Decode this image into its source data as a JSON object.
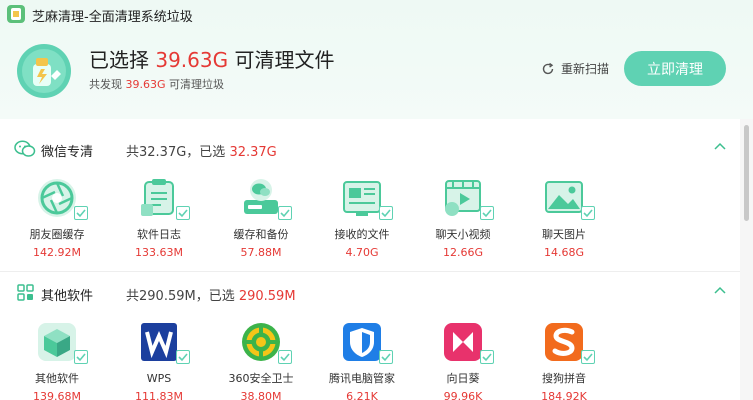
{
  "window": {
    "title": "芝麻清理-全面清理系统垃圾"
  },
  "hero": {
    "main_prefix": "已选择 ",
    "main_value": "39.63G",
    "main_suffix": " 可清理文件",
    "sub_prefix": "共发现 ",
    "sub_value": "39.63G",
    "sub_suffix": " 可清理垃圾"
  },
  "actions": {
    "rescan_label": "重新扫描",
    "clean_label": "立即清理"
  },
  "sections": [
    {
      "title": "微信专清",
      "summary_prefix": "共32.37G，已选 ",
      "summary_value": "32.37G",
      "items": [
        {
          "name": "朋友圈缓存",
          "size": "142.92M",
          "icon": "camera-aperture-icon"
        },
        {
          "name": "软件日志",
          "size": "133.63M",
          "icon": "clipboard-log-icon"
        },
        {
          "name": "缓存和备份",
          "size": "57.88M",
          "icon": "wechat-backup-icon"
        },
        {
          "name": "接收的文件",
          "size": "4.70G",
          "icon": "received-files-icon"
        },
        {
          "name": "聊天小视频",
          "size": "12.66G",
          "icon": "chat-video-icon"
        },
        {
          "name": "聊天图片",
          "size": "14.68G",
          "icon": "chat-image-icon"
        }
      ]
    },
    {
      "title": "其他软件",
      "summary_prefix": "共290.59M，已选 ",
      "summary_value": "290.59M",
      "items": [
        {
          "name": "其他软件",
          "size": "139.68M",
          "icon": "software-box-icon"
        },
        {
          "name": "WPS",
          "size": "111.83M",
          "icon": "wps-icon"
        },
        {
          "name": "360安全卫士",
          "size": "38.80M",
          "icon": "360-security-icon"
        },
        {
          "name": "腾讯电脑管家",
          "size": "6.21K",
          "icon": "tencent-pc-manager-icon"
        },
        {
          "name": "向日葵",
          "size": "99.96K",
          "icon": "sunflower-remote-icon"
        },
        {
          "name": "搜狗拼音",
          "size": "184.92K",
          "icon": "sogou-pinyin-icon"
        }
      ]
    }
  ],
  "colors": {
    "accent": "#5fd2b3",
    "highlight": "#e53935",
    "header_bg": "#eef9f4"
  }
}
